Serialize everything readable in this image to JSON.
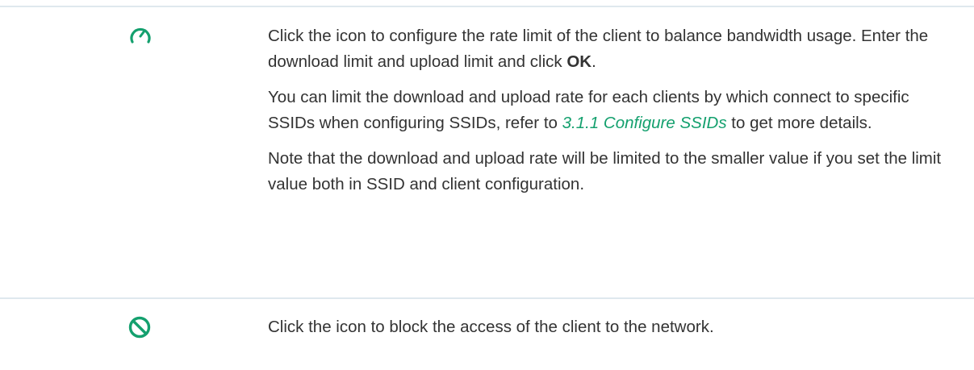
{
  "rows": [
    {
      "icon": "rate-limit-gauge-icon",
      "paragraphs": {
        "p1_before": "Click the icon to configure the rate limit of the client to balance bandwidth usage. Enter the download limit and upload limit and click ",
        "p1_bold": "OK",
        "p1_after": ".",
        "p2_before": "You can limit the download and upload rate for each clients by which connect to specific SSIDs when configuring SSIDs, refer to ",
        "p2_link": "3.1.1 Configure SSIDs",
        "p2_after": " to get more details.",
        "p3": "Note that the download and upload rate will be limited to the smaller value if you set the limit value both in SSID and client configuration."
      }
    },
    {
      "icon": "block-icon",
      "paragraphs": {
        "p1": "Click the icon to block the access of the client to the network."
      }
    }
  ],
  "colors": {
    "icon_green": "#14a06e",
    "link_green": "#14a06e",
    "divider": "#dfe8ee",
    "text": "#333333"
  }
}
